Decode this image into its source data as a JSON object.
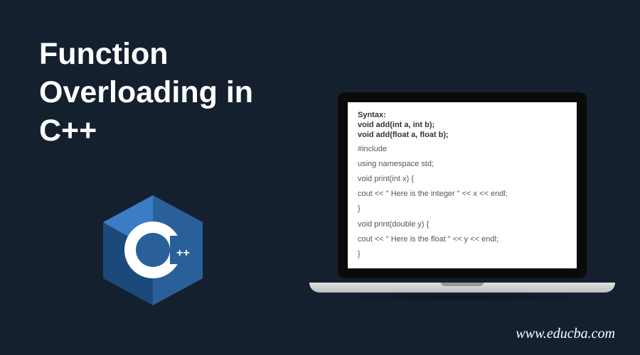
{
  "title_line1": "Function",
  "title_line2": "Overloading in",
  "title_line3": "C++",
  "logo": {
    "letter": "C",
    "suffix": "++"
  },
  "code": {
    "syntax_label": "Syntax:",
    "proto1": "void add(int a, int b);",
    "proto2": "void add(float a, float b);",
    "line1": "#include",
    "line2": "using namespace std;",
    "line3": "void print(int x) {",
    "line4": "cout << \" Here is the integer \" << x << endl;",
    "line5": "}",
    "line6": "void print(double  y) {",
    "line7": "cout << \" Here is the float \" << y << endl;",
    "line8": "}"
  },
  "footer": "www.educba.com"
}
